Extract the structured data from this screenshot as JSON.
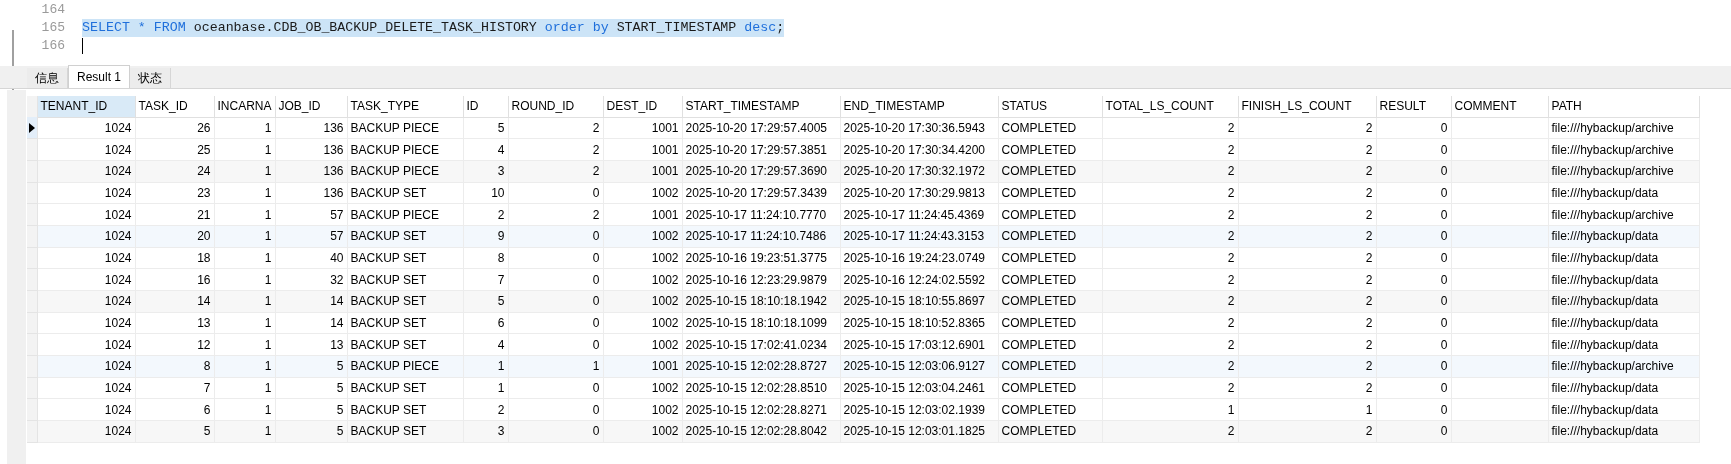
{
  "editor": {
    "lines": [
      {
        "number": "164"
      },
      {
        "number": "165",
        "selected": true,
        "tokens": [
          {
            "kind": "keyword",
            "text": "SELECT * FROM"
          },
          {
            "kind": "plain",
            "text": " oceanbase.CDB_OB_BACKUP_DELETE_TASK_HISTORY "
          },
          {
            "kind": "keyword",
            "text": "order by"
          },
          {
            "kind": "plain",
            "text": " START_TIMESTAMP "
          },
          {
            "kind": "keyword",
            "text": "desc"
          },
          {
            "kind": "plain",
            "text": ";"
          }
        ]
      },
      {
        "number": "166",
        "cursor": true
      }
    ]
  },
  "result_tabs": [
    {
      "label": "信息",
      "selected": false
    },
    {
      "label": "Result 1",
      "selected": true
    },
    {
      "label": "状态",
      "selected": false
    }
  ],
  "table": {
    "columns": [
      {
        "label": "TENANT_ID",
        "kind": "number",
        "selected": true
      },
      {
        "label": "TASK_ID",
        "kind": "number",
        "selected": false
      },
      {
        "label": "INCARNA",
        "kind": "number",
        "selected": false
      },
      {
        "label": "JOB_ID",
        "kind": "number",
        "selected": false
      },
      {
        "label": "TASK_TYPE",
        "kind": "text",
        "selected": false
      },
      {
        "label": "ID",
        "kind": "number",
        "selected": false
      },
      {
        "label": "ROUND_ID",
        "kind": "number",
        "selected": false
      },
      {
        "label": "DEST_ID",
        "kind": "number",
        "selected": false
      },
      {
        "label": "START_TIMESTAMP",
        "kind": "text",
        "selected": false
      },
      {
        "label": "END_TIMESTAMP",
        "kind": "text",
        "selected": false
      },
      {
        "label": "STATUS",
        "kind": "text",
        "selected": false
      },
      {
        "label": "TOTAL_LS_COUNT",
        "kind": "number",
        "selected": false
      },
      {
        "label": "FINISH_LS_COUNT",
        "kind": "number",
        "selected": false
      },
      {
        "label": "RESULT",
        "kind": "number",
        "selected": false
      },
      {
        "label": "COMMENT",
        "kind": "text",
        "selected": false
      },
      {
        "label": "PATH",
        "kind": "text",
        "selected": false
      }
    ],
    "rows": [
      {
        "selected": true,
        "cells": [
          "1024",
          "26",
          "1",
          "136",
          "BACKUP PIECE",
          "5",
          "2",
          "1001",
          "2025-10-20 17:29:57.4005",
          "2025-10-20 17:30:36.5943",
          "COMPLETED",
          "2",
          "2",
          "0",
          null,
          "file:///hybackup/archive"
        ]
      },
      {
        "selected": false,
        "cells": [
          "1024",
          "25",
          "1",
          "136",
          "BACKUP PIECE",
          "4",
          "2",
          "1001",
          "2025-10-20 17:29:57.3851",
          "2025-10-20 17:30:34.4200",
          "COMPLETED",
          "2",
          "2",
          "0",
          null,
          "file:///hybackup/archive"
        ]
      },
      {
        "selected": false,
        "cells": [
          "1024",
          "24",
          "1",
          "136",
          "BACKUP PIECE",
          "3",
          "2",
          "1001",
          "2025-10-20 17:29:57.3690",
          "2025-10-20 17:30:32.1972",
          "COMPLETED",
          "2",
          "2",
          "0",
          null,
          "file:///hybackup/archive"
        ]
      },
      {
        "selected": false,
        "cells": [
          "1024",
          "23",
          "1",
          "136",
          "BACKUP SET",
          "10",
          "0",
          "1002",
          "2025-10-20 17:29:57.3439",
          "2025-10-20 17:30:29.9813",
          "COMPLETED",
          "2",
          "2",
          "0",
          null,
          "file:///hybackup/data"
        ]
      },
      {
        "selected": false,
        "cells": [
          "1024",
          "21",
          "1",
          "57",
          "BACKUP PIECE",
          "2",
          "2",
          "1001",
          "2025-10-17 11:24:10.7770",
          "2025-10-17 11:24:45.4369",
          "COMPLETED",
          "2",
          "2",
          "0",
          null,
          "file:///hybackup/archive"
        ]
      },
      {
        "selected": false,
        "cells": [
          "1024",
          "20",
          "1",
          "57",
          "BACKUP SET",
          "9",
          "0",
          "1002",
          "2025-10-17 11:24:10.7486",
          "2025-10-17 11:24:43.3153",
          "COMPLETED",
          "2",
          "2",
          "0",
          null,
          "file:///hybackup/data"
        ]
      },
      {
        "selected": false,
        "cells": [
          "1024",
          "18",
          "1",
          "40",
          "BACKUP SET",
          "8",
          "0",
          "1002",
          "2025-10-16 19:23:51.3775",
          "2025-10-16 19:24:23.0749",
          "COMPLETED",
          "2",
          "2",
          "0",
          null,
          "file:///hybackup/data"
        ]
      },
      {
        "selected": false,
        "cells": [
          "1024",
          "16",
          "1",
          "32",
          "BACKUP SET",
          "7",
          "0",
          "1002",
          "2025-10-16 12:23:29.9879",
          "2025-10-16 12:24:02.5592",
          "COMPLETED",
          "2",
          "2",
          "0",
          null,
          "file:///hybackup/data"
        ]
      },
      {
        "selected": false,
        "cells": [
          "1024",
          "14",
          "1",
          "14",
          "BACKUP SET",
          "5",
          "0",
          "1002",
          "2025-10-15 18:10:18.1942",
          "2025-10-15 18:10:55.8697",
          "COMPLETED",
          "2",
          "2",
          "0",
          null,
          "file:///hybackup/data"
        ]
      },
      {
        "selected": false,
        "cells": [
          "1024",
          "13",
          "1",
          "14",
          "BACKUP SET",
          "6",
          "0",
          "1002",
          "2025-10-15 18:10:18.1099",
          "2025-10-15 18:10:52.8365",
          "COMPLETED",
          "2",
          "2",
          "0",
          null,
          "file:///hybackup/data"
        ]
      },
      {
        "selected": false,
        "cells": [
          "1024",
          "12",
          "1",
          "13",
          "BACKUP SET",
          "4",
          "0",
          "1002",
          "2025-10-15 17:02:41.0234",
          "2025-10-15 17:03:12.6901",
          "COMPLETED",
          "2",
          "2",
          "0",
          null,
          "file:///hybackup/data"
        ]
      },
      {
        "selected": false,
        "cells": [
          "1024",
          "8",
          "1",
          "5",
          "BACKUP PIECE",
          "1",
          "1",
          "1001",
          "2025-10-15 12:02:28.8727",
          "2025-10-15 12:03:06.9127",
          "COMPLETED",
          "2",
          "2",
          "0",
          null,
          "file:///hybackup/archive"
        ]
      },
      {
        "selected": false,
        "cells": [
          "1024",
          "7",
          "1",
          "5",
          "BACKUP SET",
          "1",
          "0",
          "1002",
          "2025-10-15 12:02:28.8510",
          "2025-10-15 12:03:04.2461",
          "COMPLETED",
          "2",
          "2",
          "0",
          null,
          "file:///hybackup/data"
        ]
      },
      {
        "selected": false,
        "cells": [
          "1024",
          "6",
          "1",
          "5",
          "BACKUP SET",
          "2",
          "0",
          "1002",
          "2025-10-15 12:02:28.8271",
          "2025-10-15 12:03:02.1939",
          "COMPLETED",
          "1",
          "1",
          "0",
          null,
          "file:///hybackup/data"
        ]
      },
      {
        "selected": false,
        "cells": [
          "1024",
          "5",
          "1",
          "5",
          "BACKUP SET",
          "3",
          "0",
          "1002",
          "2025-10-15 12:02:28.8042",
          "2025-10-15 12:03:01.1825",
          "COMPLETED",
          "2",
          "2",
          "0",
          null,
          "file:///hybackup/data"
        ]
      }
    ]
  }
}
